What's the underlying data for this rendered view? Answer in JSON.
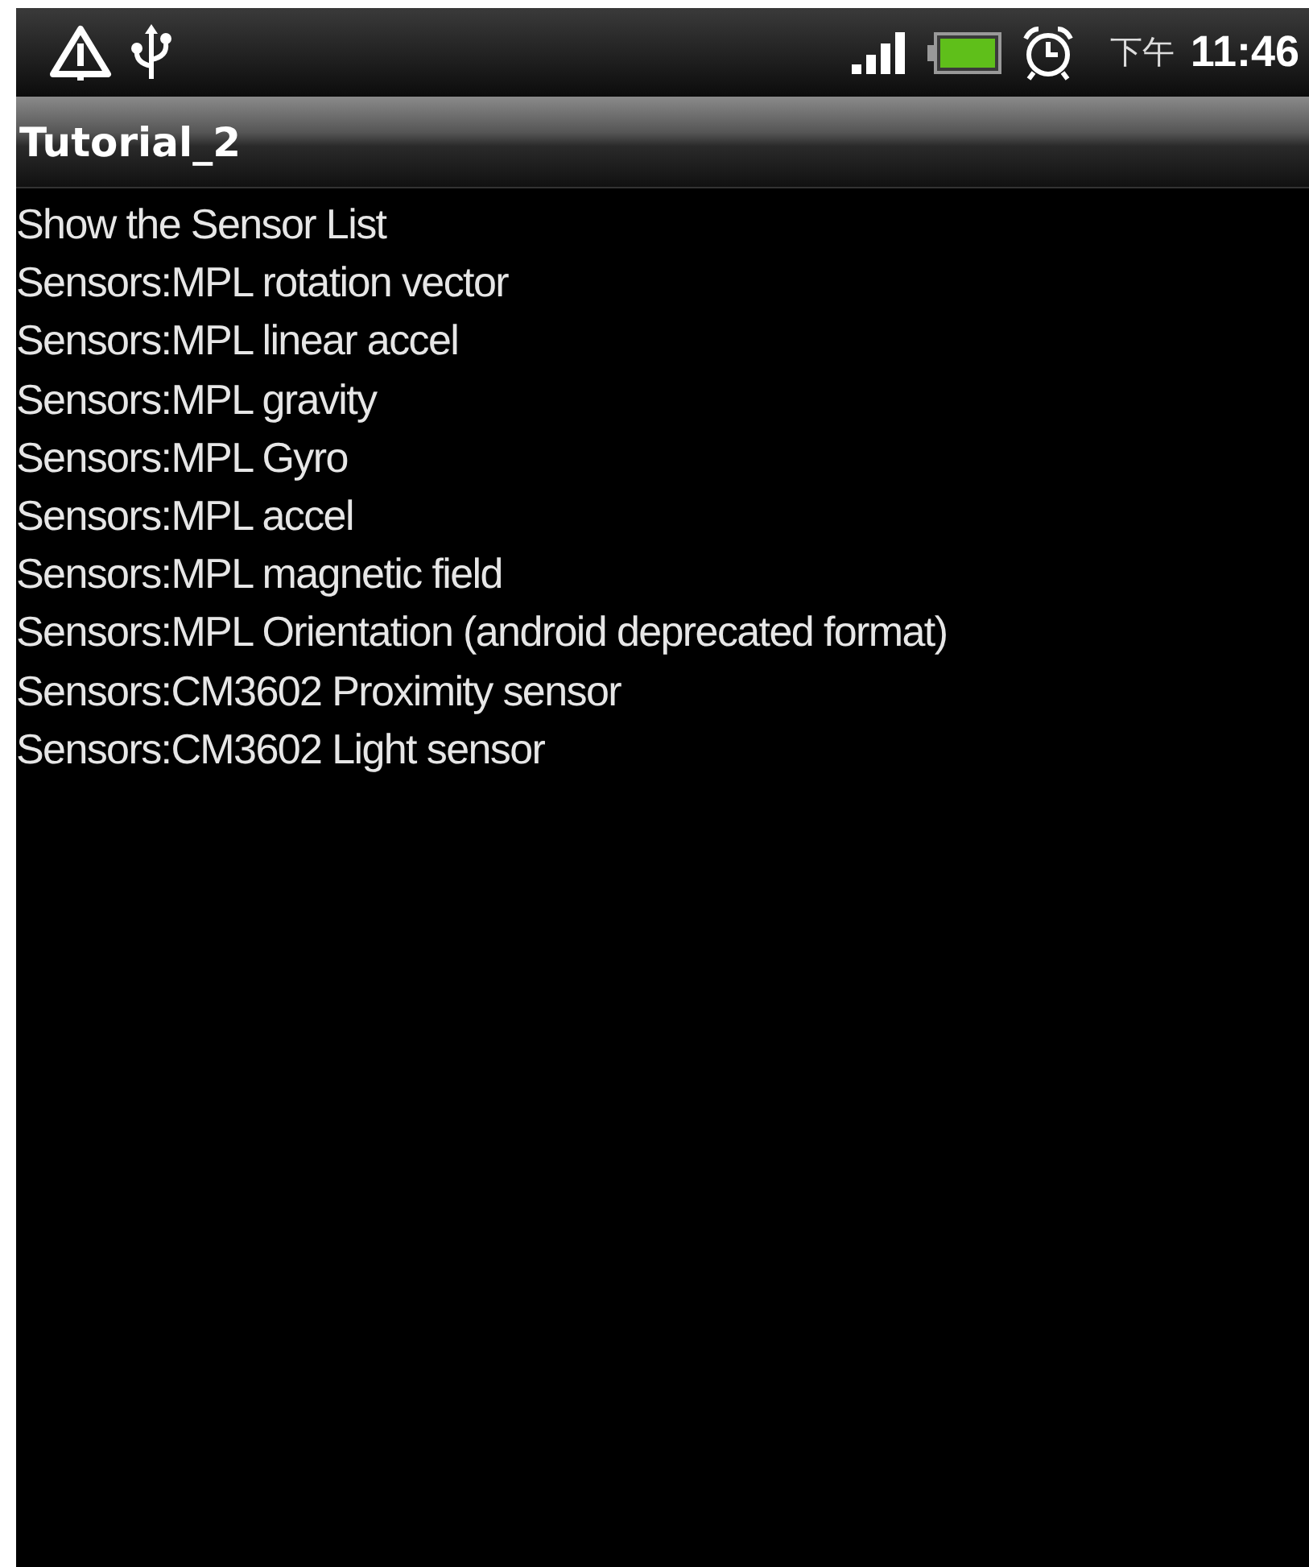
{
  "status_bar": {
    "ampm": "下午",
    "time": "11:46"
  },
  "title_bar": {
    "title": "Tutorial_2"
  },
  "lines": [
    "Show the Sensor List",
    "Sensors:MPL rotation vector",
    "Sensors:MPL linear accel",
    "Sensors:MPL gravity",
    "Sensors:MPL Gyro",
    "Sensors:MPL accel",
    "Sensors:MPL magnetic field",
    "Sensors:MPL Orientation (android deprecated format)",
    "Sensors:CM3602 Proximity sensor",
    "Sensors:CM3602 Light sensor"
  ]
}
